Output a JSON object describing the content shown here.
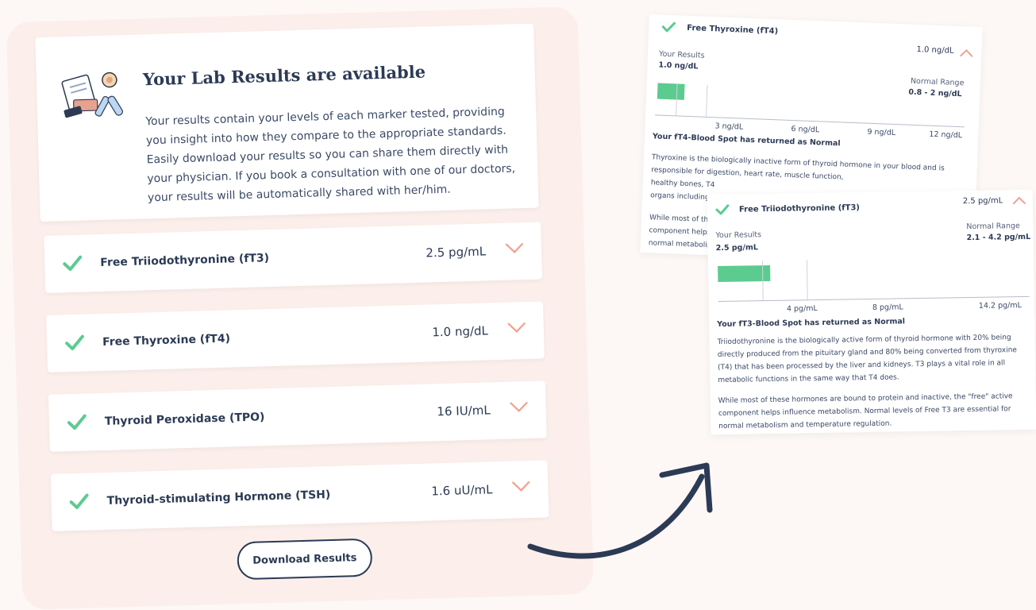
{
  "intro": {
    "title": "Your Lab Results are available",
    "body": "Your results contain your levels of each marker tested, providing you insight into how they compare to the appropriate standards. Easily download your results so you can share them directly with your physician. If you book a consultation with one of our doctors, your results will be automatically shared with her/him."
  },
  "results": [
    {
      "name": "Free Triiodothyronine (fT3)",
      "value": "2.5 pg/mL"
    },
    {
      "name": "Free Thyroxine (fT4)",
      "value": "1.0 ng/dL"
    },
    {
      "name": "Thyroid Peroxidase (TPO)",
      "value": "16 IU/mL"
    },
    {
      "name": "Thyroid-stimulating Hormone (TSH)",
      "value": "1.6 uU/mL"
    }
  ],
  "download_label": "Download Results",
  "detail_ft4": {
    "name": "Free Thyroxine (fT4)",
    "value": "1.0 ng/dL",
    "your_results_label": "Your Results",
    "your_results_value": "1.0 ng/dL",
    "normal_range_label": "Normal Range",
    "normal_range_value": "0.8 - 2 ng/dL",
    "ticks": [
      "3 ng/dL",
      "6 ng/dL",
      "9 ng/dL",
      "12 ng/dL"
    ],
    "status": "Your fT4-Blood Spot has returned as Normal",
    "p1_l1": "Thyroxine is the biologically inactive form of thyroid hormone in your blood and is",
    "p1_l2": "responsible for digestion, heart rate, muscle function,",
    "p1_l3": "healthy bones, T4",
    "p1_l4": "organs including",
    "p2_l1": "While most of the",
    "p2_l2": "component helps",
    "p2_l3": "normal metabolis"
  },
  "detail_ft3": {
    "name": "Free Triiodothyronine (fT3)",
    "value": "2.5 pg/mL",
    "your_results_label": "Your Results",
    "your_results_value": "2.5 pg/mL",
    "normal_range_label": "Normal Range",
    "normal_range_value": "2.1 - 4.2 pg/mL",
    "ticks": [
      "4 pg/mL",
      "8 pg/mL",
      "14.2 pg/mL"
    ],
    "status": "Your fT3-Blood Spot has returned as Normal",
    "p1": "Triiodothyronine is the biologically active form of thyroid hormone with 20% being directly produced from the pituitary gland and 80% being converted from thyroxine (T4) that has been processed by the liver and kidneys. T3 plays a vital role in all metabolic functions in the same way that T4 does.",
    "p2": "While most of these hormones are bound to protein and inactive, the \"free\" active component helps influence metabolism. Normal levels of Free T3 are essential for normal metabolism and temperature regulation."
  },
  "colors": {
    "check": "#5ccb8f",
    "chevron": "#f2a08e",
    "navy": "#2c3a55",
    "panel": "#fcefeb"
  }
}
